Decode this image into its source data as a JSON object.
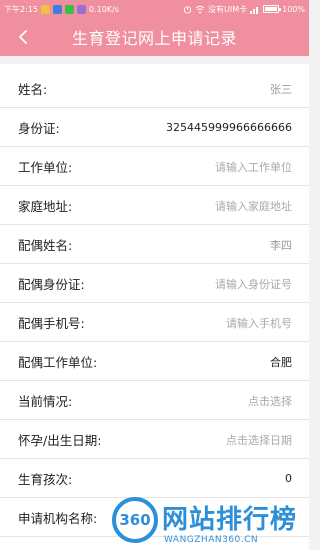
{
  "status_bar": {
    "time": "下午2:15",
    "speed": "0.10K/s",
    "carrier": "没有UIM卡",
    "battery": "100%",
    "battery_level": 1.0
  },
  "header": {
    "title": "生育登记网上申请记录",
    "back_icon": "chevron-left-icon"
  },
  "form": {
    "rows": [
      {
        "label": "姓名:",
        "value": "张三"
      },
      {
        "label": "身份证:",
        "value": "325445999966666666"
      },
      {
        "label": "工作单位:",
        "value": "请输入工作单位"
      },
      {
        "label": "家庭地址:",
        "value": "请输入家庭地址"
      },
      {
        "label": "配偶姓名:",
        "value": "李四"
      },
      {
        "label": "配偶身份证:",
        "value": "请输入身份证号"
      },
      {
        "label": "配偶手机号:",
        "value": "请输入手机号"
      },
      {
        "label": "配偶工作单位:",
        "value": "合肥"
      },
      {
        "label": "当前情况:",
        "value": "点击选择"
      },
      {
        "label": "怀孕/出生日期:",
        "value": "点击选择日期"
      },
      {
        "label": "生育孩次:",
        "value": "0"
      },
      {
        "label": "申请机构名称:",
        "value": ""
      }
    ]
  },
  "watermark": {
    "badge": "360",
    "main": "网站排行榜",
    "sub": "WANGZHAN360.CN"
  },
  "colors": {
    "accent": "#ef8f9f",
    "watermark": "#2e8fd9"
  }
}
